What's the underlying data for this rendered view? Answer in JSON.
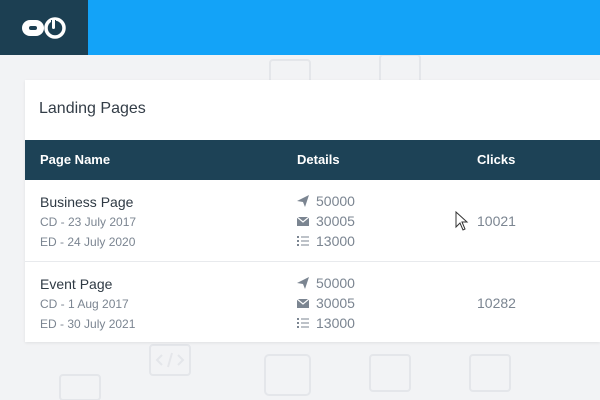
{
  "header": {
    "logo_icon": "link-logo-icon",
    "accent": "#13a3f8",
    "logo_bg": "#1c3f52"
  },
  "card": {
    "title": "Landing Pages",
    "columns": [
      "Page Name",
      "Details",
      "Clicks"
    ],
    "rows": [
      {
        "name": "Business Page",
        "created": "CD - 23 July 2017",
        "ends": "ED - 24 July 2020",
        "details": [
          {
            "icon": "paper-plane-icon",
            "value": "50000"
          },
          {
            "icon": "envelope-icon",
            "value": "30005"
          },
          {
            "icon": "list-icon",
            "value": "13000"
          }
        ],
        "clicks": "10021"
      },
      {
        "name": "Event Page",
        "created": "CD - 1 Aug 2017",
        "ends": "ED - 30 July 2021",
        "details": [
          {
            "icon": "paper-plane-icon",
            "value": "50000"
          },
          {
            "icon": "envelope-icon",
            "value": "30005"
          },
          {
            "icon": "list-icon",
            "value": "13000"
          }
        ],
        "clicks": "10282"
      }
    ]
  }
}
